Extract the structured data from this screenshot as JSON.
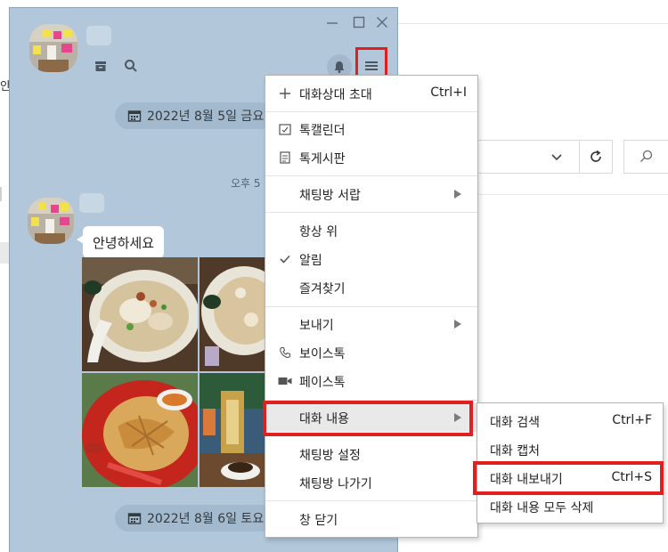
{
  "background": {
    "left_partial_text": "안전",
    "refresh_icon": "refresh-icon",
    "search_icon": "search-icon"
  },
  "chat": {
    "window_controls": [
      "minimize-icon",
      "maximize-icon",
      "close-icon"
    ],
    "head_icons": [
      "drawer-icon",
      "search-icon",
      "bell-icon",
      "hamburger-menu-icon"
    ],
    "date1": "2022년 8월 5일 금요일",
    "time": "오후 5",
    "message": "안녕하세요",
    "date2": "2022년 8월 6일 토요일"
  },
  "menu": {
    "items": [
      {
        "label": "대화상대 초대",
        "shortcut": "Ctrl+I",
        "icon": "plus-icon"
      },
      {
        "label": "톡캘린더",
        "icon": "calendar-check-icon"
      },
      {
        "label": "톡게시판",
        "icon": "document-icon"
      },
      {
        "label": "채팅방 서랍",
        "submenu": true
      },
      {
        "label": "항상 위"
      },
      {
        "label": "알림",
        "checked": true,
        "icon": "checkmark-icon"
      },
      {
        "label": "즐겨찾기"
      },
      {
        "label": "보내기",
        "submenu": true
      },
      {
        "label": "보이스톡",
        "icon": "phone-icon"
      },
      {
        "label": "페이스톡",
        "icon": "video-camera-icon"
      },
      {
        "label": "대화 내용",
        "submenu": true,
        "active": true
      },
      {
        "label": "채팅방 설정"
      },
      {
        "label": "채팅방 나가기"
      },
      {
        "label": "창 닫기"
      }
    ]
  },
  "submenu": {
    "items": [
      {
        "label": "대화 검색",
        "shortcut": "Ctrl+F"
      },
      {
        "label": "대화 캡처"
      },
      {
        "label": "대화 내보내기",
        "shortcut": "Ctrl+S"
      },
      {
        "label": "대화 내용 모두 삭제"
      }
    ]
  },
  "colors": {
    "chat_background": "#b2c7da",
    "highlight": "#e02020",
    "menu_active": "#e9e9e9"
  }
}
